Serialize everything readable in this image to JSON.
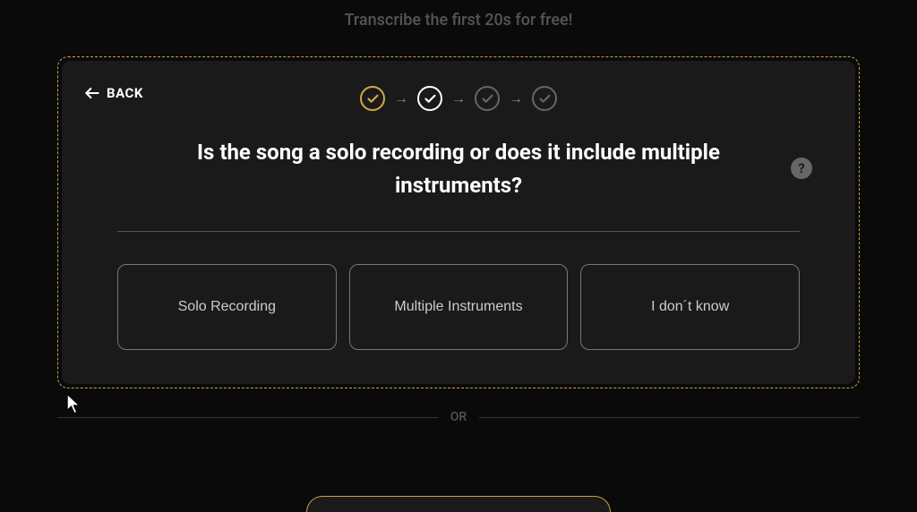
{
  "banner": {
    "text": "Transcribe the first 20s for free!"
  },
  "modal": {
    "back_label": "BACK",
    "question": "Is the song a solo recording or does it include multiple instruments?",
    "help_char": "?",
    "options": [
      {
        "label": "Solo Recording"
      },
      {
        "label": "Multiple Instruments"
      },
      {
        "label": "I don´t know"
      }
    ]
  },
  "or_divider": {
    "label": "OR"
  },
  "colors": {
    "accent": "#d4a843",
    "accent_border": "#cba049"
  }
}
